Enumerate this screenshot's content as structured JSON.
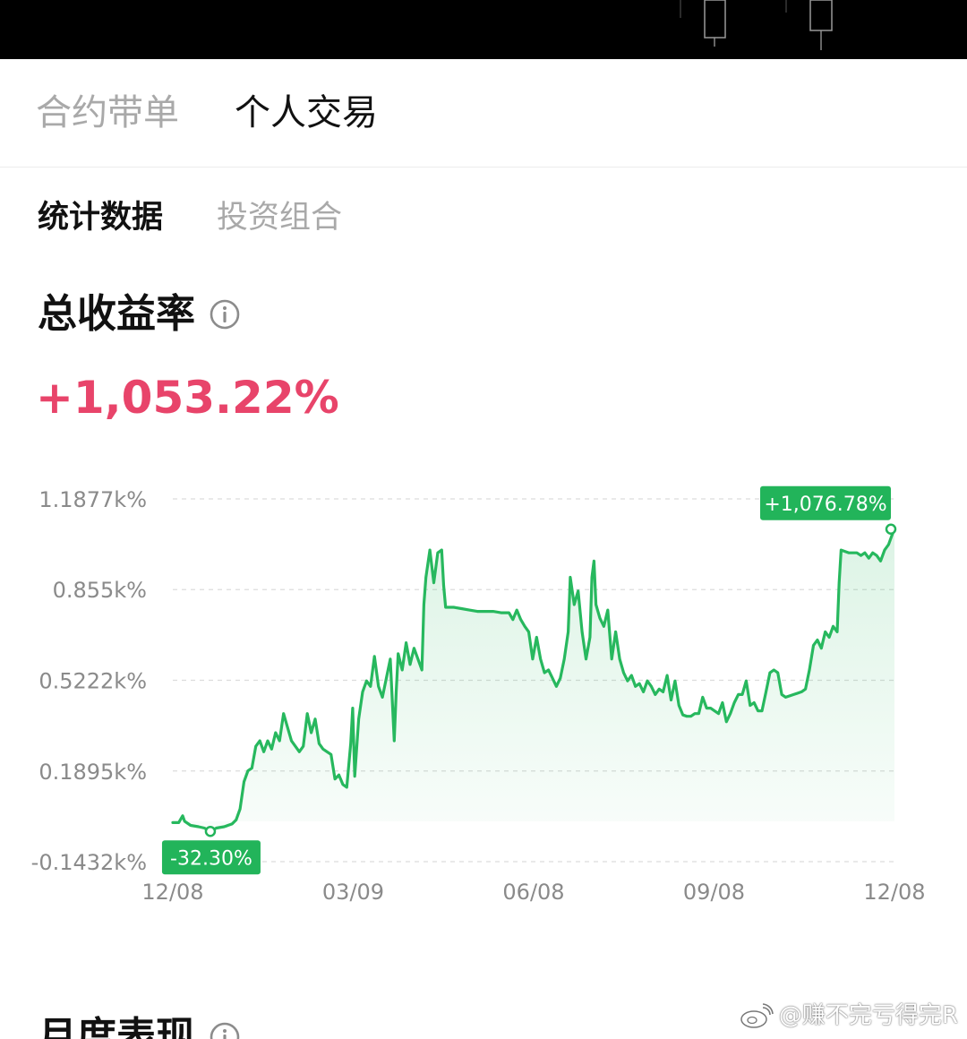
{
  "main_tabs": [
    {
      "label": "合约带单",
      "active": false
    },
    {
      "label": "个人交易",
      "active": true
    }
  ],
  "sub_tabs": [
    {
      "label": "统计数据",
      "active": true
    },
    {
      "label": "投资组合",
      "active": false
    }
  ],
  "total_return": {
    "title": "总收益率",
    "value": "+1,053.22%",
    "value_color": "#e8446a"
  },
  "next_section": {
    "title": "月度表现"
  },
  "watermark": {
    "text": "@赚不完亏得完R"
  },
  "icons": [
    "info-icon",
    "weibo-icon"
  ],
  "colors": {
    "positive_red": "#e8446a",
    "chart_green": "#27b85e",
    "label_green": "#22b45a",
    "muted_text": "#a9a9a9"
  },
  "chart_data": {
    "type": "area",
    "y_unit": "k%",
    "y_ticks": [
      "1.1877k%",
      "0.855k%",
      "0.5222k%",
      "0.1895k%",
      "-0.1432k%"
    ],
    "y_tick_values": [
      1187.7,
      855.0,
      522.2,
      189.5,
      -143.2
    ],
    "ylim": [
      -143.2,
      1187.7
    ],
    "x_ticks": [
      "12/08",
      "03/09",
      "06/08",
      "09/08",
      "12/08"
    ],
    "xlim": [
      0,
      365
    ],
    "grid": true,
    "max_label": "+1,076.78%",
    "min_label": "-32.30%",
    "max_point": [
      365,
      1076.78
    ],
    "min_point": [
      19,
      -32.3
    ],
    "series": [
      {
        "values": [
          [
            0,
            0
          ],
          [
            3,
            0
          ],
          [
            5,
            25
          ],
          [
            6,
            5
          ],
          [
            9,
            -10
          ],
          [
            13,
            -15
          ],
          [
            16,
            -20
          ],
          [
            19,
            -32.3
          ],
          [
            22,
            -20
          ],
          [
            26,
            -15
          ],
          [
            30,
            -5
          ],
          [
            32,
            10
          ],
          [
            34,
            50
          ],
          [
            36,
            150
          ],
          [
            38,
            190
          ],
          [
            40,
            200
          ],
          [
            42,
            280
          ],
          [
            44,
            300
          ],
          [
            46,
            260
          ],
          [
            48,
            300
          ],
          [
            50,
            270
          ],
          [
            52,
            330
          ],
          [
            54,
            300
          ],
          [
            56,
            400
          ],
          [
            58,
            350
          ],
          [
            60,
            300
          ],
          [
            62,
            280
          ],
          [
            64,
            260
          ],
          [
            66,
            280
          ],
          [
            68,
            400
          ],
          [
            70,
            330
          ],
          [
            72,
            380
          ],
          [
            74,
            290
          ],
          [
            76,
            270
          ],
          [
            78,
            260
          ],
          [
            80,
            250
          ],
          [
            82,
            160
          ],
          [
            84,
            175
          ],
          [
            86,
            140
          ],
          [
            88,
            130
          ],
          [
            90,
            290
          ],
          [
            91,
            420
          ],
          [
            92,
            170
          ],
          [
            94,
            380
          ],
          [
            96,
            480
          ],
          [
            98,
            520
          ],
          [
            100,
            500
          ],
          [
            102,
            610
          ],
          [
            104,
            500
          ],
          [
            106,
            460
          ],
          [
            108,
            530
          ],
          [
            110,
            600
          ],
          [
            112,
            300
          ],
          [
            113,
            480
          ],
          [
            114,
            620
          ],
          [
            116,
            560
          ],
          [
            118,
            660
          ],
          [
            120,
            580
          ],
          [
            122,
            640
          ],
          [
            124,
            600
          ],
          [
            126,
            560
          ],
          [
            127,
            800
          ],
          [
            128,
            900
          ],
          [
            130,
            1000
          ],
          [
            132,
            880
          ],
          [
            134,
            990
          ],
          [
            136,
            1000
          ],
          [
            137,
            870
          ],
          [
            138,
            790
          ],
          [
            142,
            790
          ],
          [
            146,
            785
          ],
          [
            150,
            780
          ],
          [
            154,
            775
          ],
          [
            158,
            775
          ],
          [
            162,
            775
          ],
          [
            166,
            770
          ],
          [
            170,
            770
          ],
          [
            172,
            745
          ],
          [
            174,
            780
          ],
          [
            176,
            745
          ],
          [
            178,
            720
          ],
          [
            180,
            700
          ],
          [
            182,
            600
          ],
          [
            184,
            680
          ],
          [
            186,
            600
          ],
          [
            188,
            550
          ],
          [
            190,
            560
          ],
          [
            192,
            530
          ],
          [
            194,
            500
          ],
          [
            196,
            530
          ],
          [
            198,
            600
          ],
          [
            200,
            700
          ],
          [
            201,
            900
          ],
          [
            203,
            800
          ],
          [
            205,
            850
          ],
          [
            207,
            700
          ],
          [
            209,
            600
          ],
          [
            211,
            680
          ],
          [
            212,
            900
          ],
          [
            213,
            960
          ],
          [
            214,
            800
          ],
          [
            216,
            750
          ],
          [
            218,
            720
          ],
          [
            220,
            780
          ],
          [
            222,
            600
          ],
          [
            224,
            700
          ],
          [
            226,
            600
          ],
          [
            228,
            550
          ],
          [
            230,
            520
          ],
          [
            232,
            540
          ],
          [
            234,
            500
          ],
          [
            236,
            510
          ],
          [
            238,
            480
          ],
          [
            240,
            520
          ],
          [
            242,
            500
          ],
          [
            244,
            470
          ],
          [
            246,
            490
          ],
          [
            248,
            480
          ],
          [
            250,
            540
          ],
          [
            252,
            450
          ],
          [
            254,
            520
          ],
          [
            256,
            430
          ],
          [
            258,
            395
          ],
          [
            260,
            390
          ],
          [
            262,
            390
          ],
          [
            264,
            400
          ],
          [
            266,
            400
          ],
          [
            268,
            460
          ],
          [
            270,
            420
          ],
          [
            272,
            420
          ],
          [
            274,
            410
          ],
          [
            276,
            400
          ],
          [
            278,
            440
          ],
          [
            280,
            370
          ],
          [
            282,
            400
          ],
          [
            284,
            440
          ],
          [
            286,
            470
          ],
          [
            288,
            470
          ],
          [
            290,
            520
          ],
          [
            292,
            430
          ],
          [
            294,
            440
          ],
          [
            296,
            410
          ],
          [
            298,
            410
          ],
          [
            300,
            480
          ],
          [
            302,
            550
          ],
          [
            304,
            560
          ],
          [
            306,
            550
          ],
          [
            308,
            470
          ],
          [
            310,
            460
          ],
          [
            312,
            465
          ],
          [
            314,
            470
          ],
          [
            318,
            480
          ],
          [
            320,
            490
          ],
          [
            322,
            560
          ],
          [
            324,
            650
          ],
          [
            326,
            670
          ],
          [
            328,
            640
          ],
          [
            330,
            700
          ],
          [
            332,
            680
          ],
          [
            334,
            720
          ],
          [
            336,
            700
          ],
          [
            337,
            880
          ],
          [
            338,
            1000
          ],
          [
            342,
            990
          ],
          [
            346,
            990
          ],
          [
            348,
            980
          ],
          [
            350,
            990
          ],
          [
            352,
            970
          ],
          [
            354,
            990
          ],
          [
            356,
            980
          ],
          [
            358,
            960
          ],
          [
            360,
            1000
          ],
          [
            362,
            1020
          ],
          [
            364,
            1060
          ],
          [
            365,
            1076.78
          ]
        ]
      }
    ]
  }
}
